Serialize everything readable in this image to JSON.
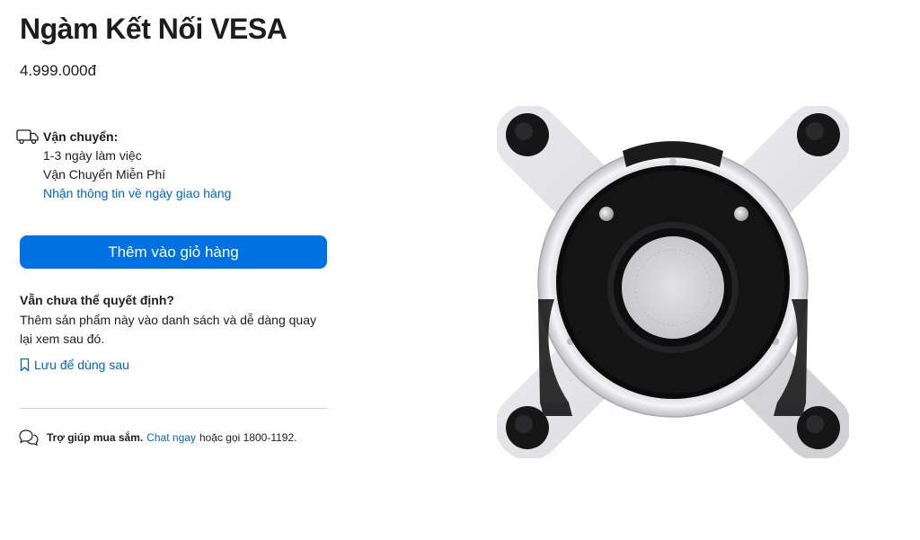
{
  "product": {
    "title": "Ngàm Kết Nối VESA",
    "price": "4.999.000đ"
  },
  "shipping": {
    "label": "Vận chuyển:",
    "days": "1-3 ngày làm việc",
    "type": "Vận Chuyển Miễn Phí",
    "link": "Nhận thông tin về ngày giao hàng"
  },
  "cart": {
    "button_label": "Thêm vào giỏ hàng"
  },
  "decide": {
    "title": "Vẫn chưa thể quyết định?",
    "text": "Thêm sản phẩm này vào danh sách và dễ dàng quay lại xem sau đó.",
    "save_label": "Lưu để dùng sau"
  },
  "help": {
    "prefix": "Trợ giúp mua sắm.",
    "chat": "Chat ngay",
    "suffix": "hoặc gọi 1800-1192."
  },
  "icons": {
    "shipping": "truck-icon",
    "save": "bookmark-icon",
    "help": "chat-bubbles-icon"
  },
  "colors": {
    "accent": "#0071e3",
    "link": "#0066cc",
    "text": "#1d1d1f"
  }
}
